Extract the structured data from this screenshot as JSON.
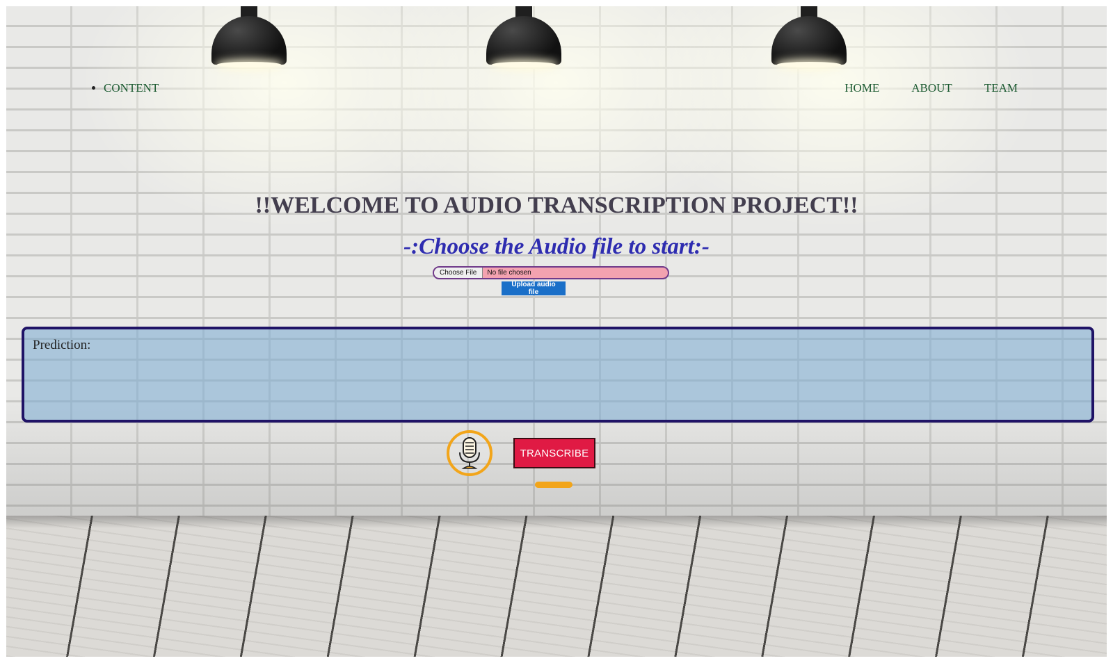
{
  "nav": {
    "left_items": [
      {
        "label": "CONTENT"
      }
    ],
    "right_items": [
      {
        "label": "HOME"
      },
      {
        "label": "ABOUT"
      },
      {
        "label": "TEAM"
      }
    ]
  },
  "heading": {
    "title": "!!WELCOME TO AUDIO TRANSCRIPTION PROJECT!!",
    "subtitle": "-:Choose the Audio file to start:-"
  },
  "upload": {
    "choose_label": "Choose File",
    "status_text": "No file chosen",
    "upload_label": "Upload audio file"
  },
  "prediction": {
    "label": "Prediction:",
    "value": ""
  },
  "controls": {
    "mic_icon": "microphone-icon",
    "transcribe_label": "TRANSCRIBE"
  },
  "colors": {
    "accent_orange": "#f2a51a",
    "transcribe_red": "#e01a44",
    "upload_blue": "#1a6fc8",
    "prediction_border": "#1f1366",
    "nav_green": "#1d5b32",
    "subtitle_blue": "#2e2cb0"
  }
}
